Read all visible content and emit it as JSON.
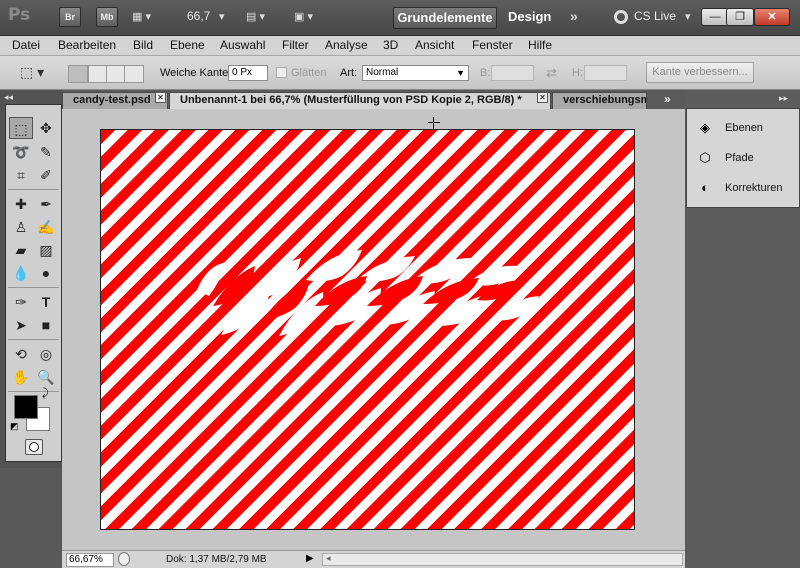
{
  "app": {
    "logo": "Ps"
  },
  "topbar": {
    "br_label": "Br",
    "mb_label": "Mb",
    "zoom_value": "66,7",
    "workspace_active": "Grundelemente",
    "workspace_design": "Design",
    "more": "»",
    "cslive": "CS Live",
    "window_minimize": "—",
    "window_restore": "❐",
    "window_close": "✕"
  },
  "menu": {
    "items": [
      "Datei",
      "Bearbeiten",
      "Bild",
      "Ebene",
      "Auswahl",
      "Filter",
      "Analyse",
      "3D",
      "Ansicht",
      "Fenster",
      "Hilfe"
    ]
  },
  "options": {
    "feather_label": "Weiche Kante:",
    "feather_value": "0 Px",
    "antialias_label": "Glätten",
    "style_label": "Art:",
    "style_value": "Normal",
    "width_label": "B:",
    "height_label": "H:",
    "refine_button": "Kante verbessern..."
  },
  "tabs": [
    {
      "label": "candy-test.psd",
      "close": "✕"
    },
    {
      "label": "Unbenannt-1 bei 66,7% (Musterfüllung von PSD  Kopie 2, RGB/8) *",
      "close": "✕"
    },
    {
      "label": "verschiebungsm",
      "close": ""
    }
  ],
  "tabs_more": "»",
  "status": {
    "zoom": "66,67%",
    "doc": "Dok: 1,37 MB/2,79 MB"
  },
  "panels": {
    "items": [
      {
        "label": "Ebenen",
        "icon": "layers-icon"
      },
      {
        "label": "Pfade",
        "icon": "paths-icon"
      },
      {
        "label": "Korrekturen",
        "icon": "adjustments-icon"
      }
    ]
  },
  "colors": {
    "stripe_red": "#ff0000",
    "stripe_white": "#ffffff",
    "foreground": "#000000",
    "background": "#ffffff"
  }
}
